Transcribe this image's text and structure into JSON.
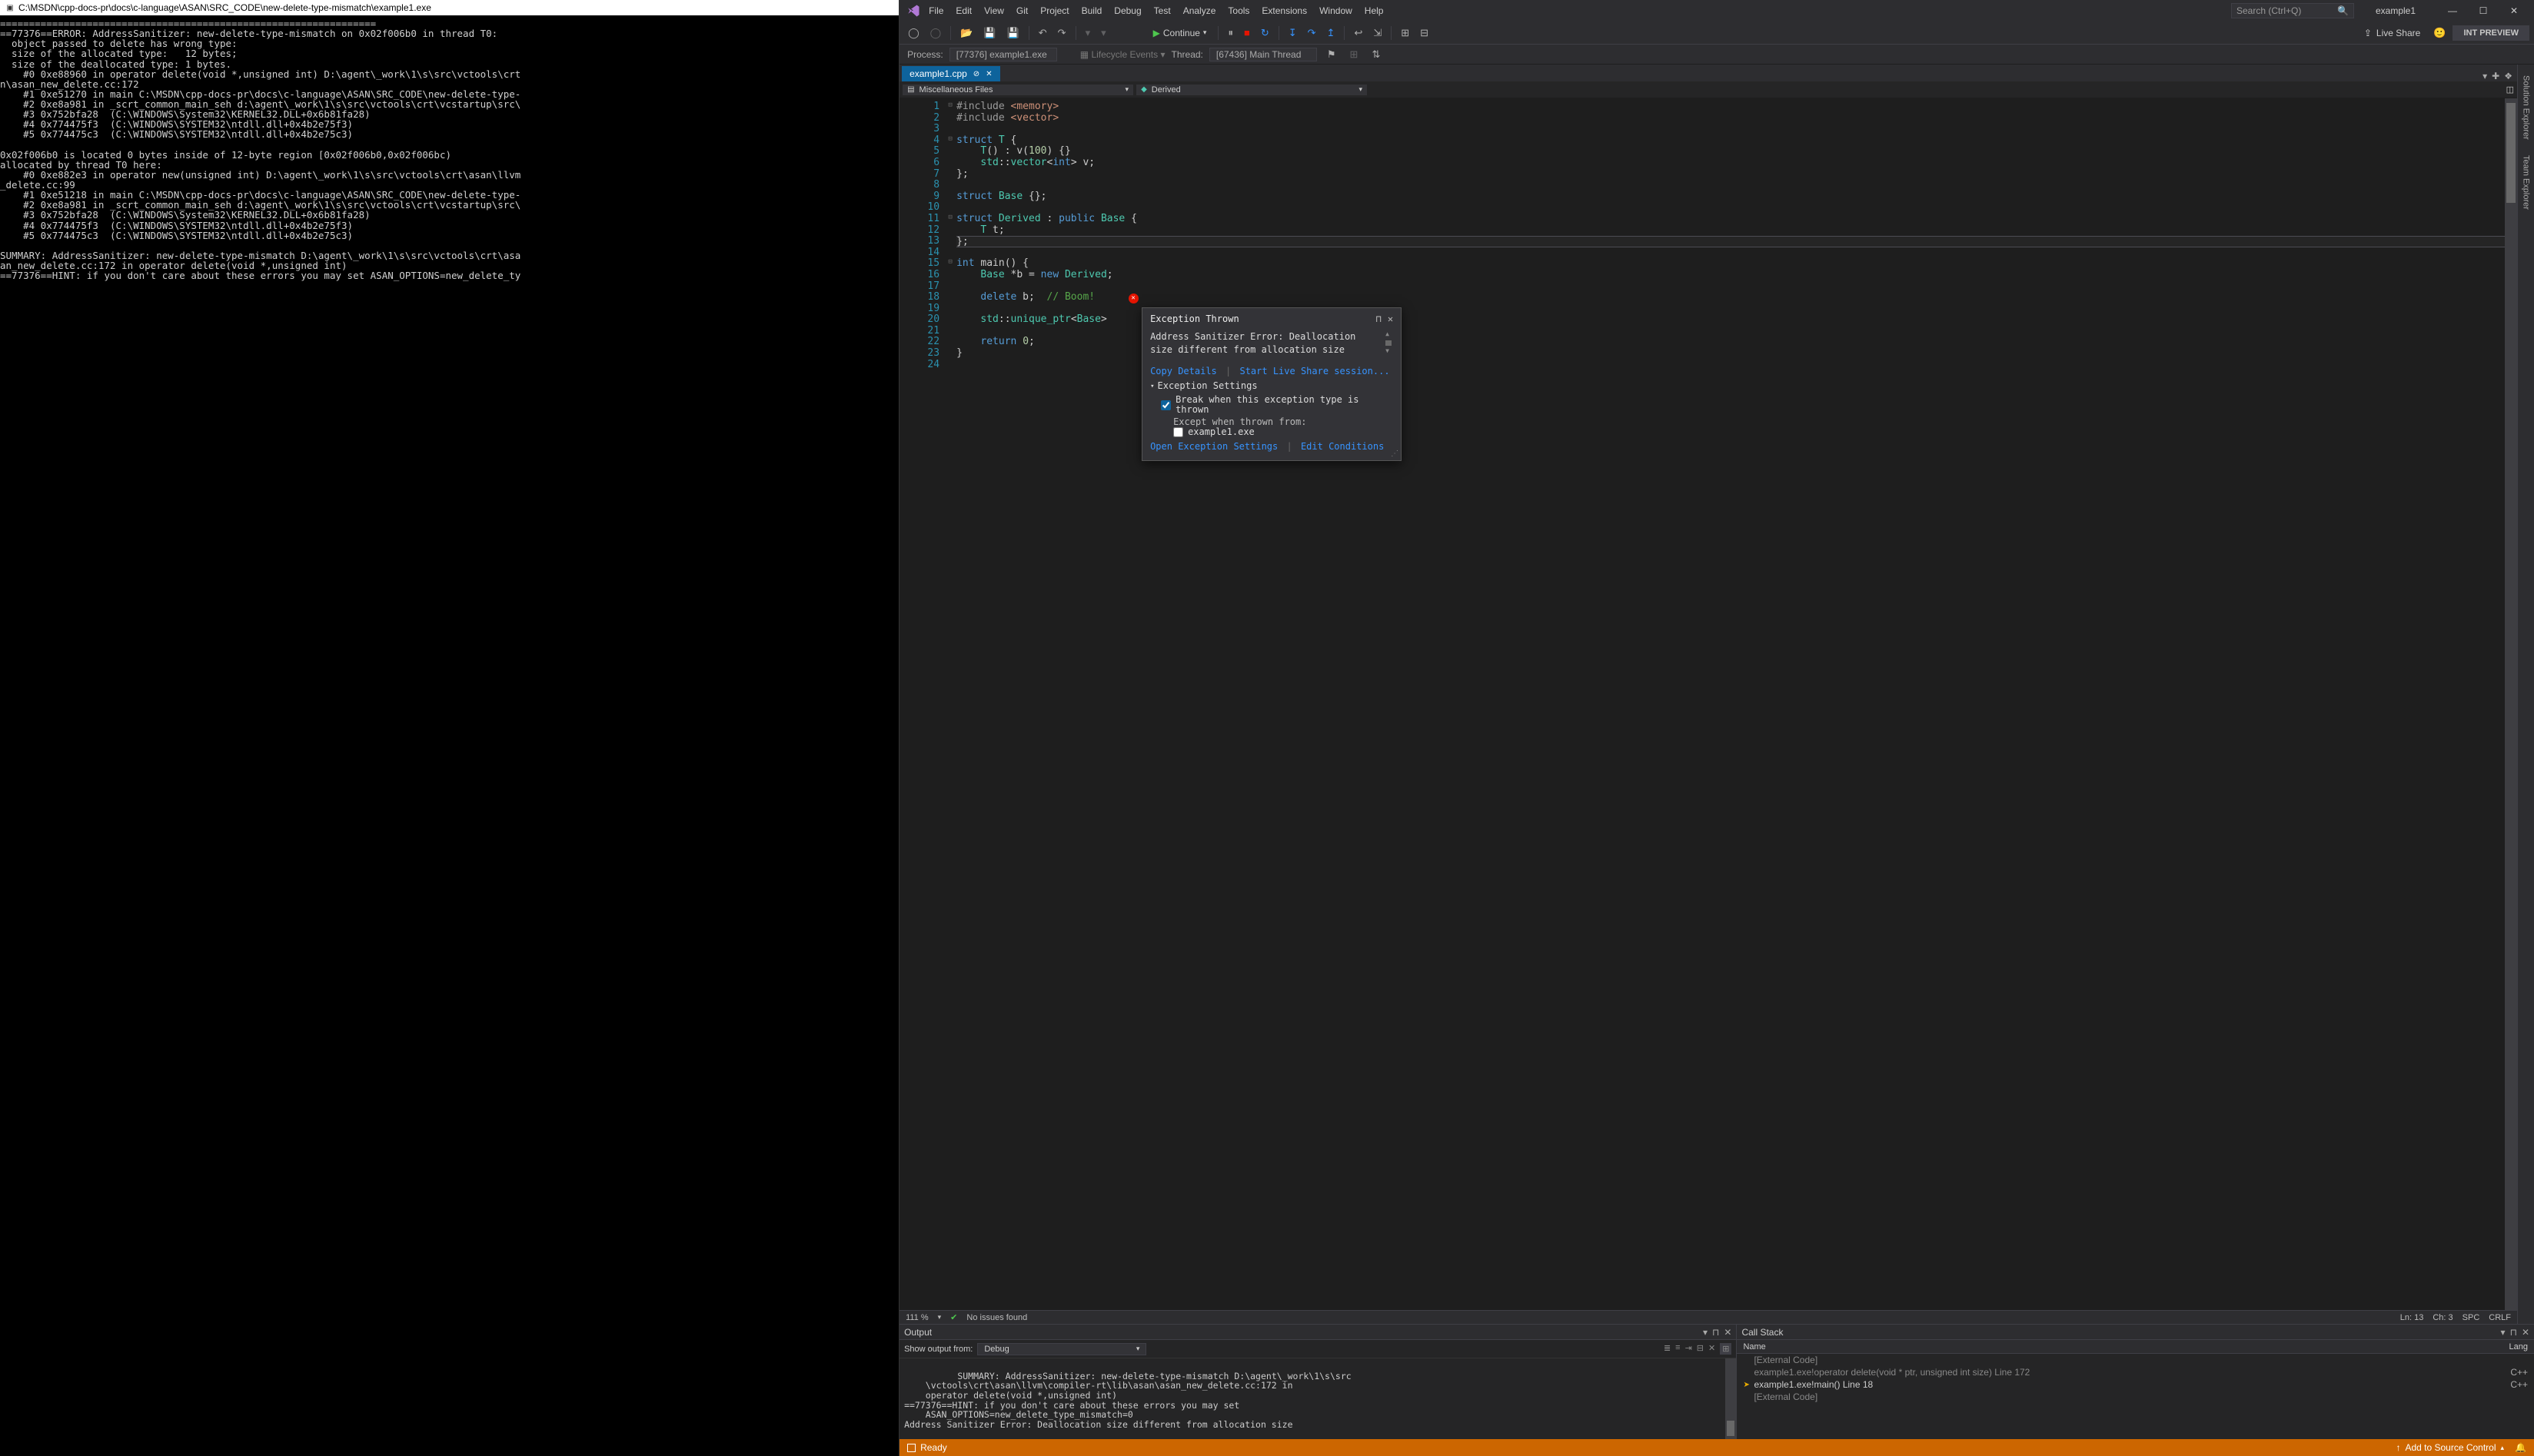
{
  "console": {
    "title": "C:\\MSDN\\cpp-docs-pr\\docs\\c-language\\ASAN\\SRC_CODE\\new-delete-type-mismatch\\example1.exe",
    "body": "=================================================================\n==77376==ERROR: AddressSanitizer: new-delete-type-mismatch on 0x02f006b0 in thread T0:\n  object passed to delete has wrong type:\n  size of the allocated type:   12 bytes;\n  size of the deallocated type: 1 bytes.\n    #0 0xe88960 in operator delete(void *,unsigned int) D:\\agent\\_work\\1\\s\\src\\vctools\\crt\nn\\asan_new_delete.cc:172\n    #1 0xe51270 in main C:\\MSDN\\cpp-docs-pr\\docs\\c-language\\ASAN\\SRC_CODE\\new-delete-type-\n    #2 0xe8a981 in _scrt_common_main_seh d:\\agent\\_work\\1\\s\\src\\vctools\\crt\\vcstartup\\src\\\n    #3 0x752bfa28  (C:\\WINDOWS\\System32\\KERNEL32.DLL+0x6b81fa28)\n    #4 0x774475f3  (C:\\WINDOWS\\SYSTEM32\\ntdll.dll+0x4b2e75f3)\n    #5 0x774475c3  (C:\\WINDOWS\\SYSTEM32\\ntdll.dll+0x4b2e75c3)\n\n0x02f006b0 is located 0 bytes inside of 12-byte region [0x02f006b0,0x02f006bc)\nallocated by thread T0 here:\n    #0 0xe882e3 in operator new(unsigned int) D:\\agent\\_work\\1\\s\\src\\vctools\\crt\\asan\\llvm\n_delete.cc:99\n    #1 0xe51218 in main C:\\MSDN\\cpp-docs-pr\\docs\\c-language\\ASAN\\SRC_CODE\\new-delete-type-\n    #2 0xe8a981 in _scrt_common_main_seh d:\\agent\\_work\\1\\s\\src\\vctools\\crt\\vcstartup\\src\\\n    #3 0x752bfa28  (C:\\WINDOWS\\System32\\KERNEL32.DLL+0x6b81fa28)\n    #4 0x774475f3  (C:\\WINDOWS\\SYSTEM32\\ntdll.dll+0x4b2e75f3)\n    #5 0x774475c3  (C:\\WINDOWS\\SYSTEM32\\ntdll.dll+0x4b2e75c3)\n\nSUMMARY: AddressSanitizer: new-delete-type-mismatch D:\\agent\\_work\\1\\s\\src\\vctools\\crt\\asa\nan_new_delete.cc:172 in operator delete(void *,unsigned int)\n==77376==HINT: if you don't care about these errors you may set ASAN_OPTIONS=new_delete_ty"
  },
  "menu": [
    "File",
    "Edit",
    "View",
    "Git",
    "Project",
    "Build",
    "Debug",
    "Test",
    "Analyze",
    "Tools",
    "Extensions",
    "Window",
    "Help"
  ],
  "search_placeholder": "Search (Ctrl+Q)",
  "solution": "example1",
  "toolbar": {
    "continue": "Continue",
    "live_share": "Live Share",
    "int_preview": "INT PREVIEW"
  },
  "process": {
    "label": "Process:",
    "value": "[77376] example1.exe",
    "lifecycle": "Lifecycle Events",
    "thread_label": "Thread:",
    "thread_value": "[67436] Main Thread"
  },
  "tab": {
    "name": "example1.cpp"
  },
  "nav": {
    "left": "Miscellaneous Files",
    "right": "Derived"
  },
  "code_lines": 24,
  "editor_status": {
    "zoom": "111 %",
    "issues": "No issues found",
    "ln": "Ln: 13",
    "ch": "Ch: 3",
    "spc": "SPC",
    "crlf": "CRLF"
  },
  "exception": {
    "title": "Exception Thrown",
    "message": "Address Sanitizer Error: Deallocation size different from allocation size",
    "copy": "Copy Details",
    "live": "Start Live Share session...",
    "settings_hdr": "Exception Settings",
    "break_label": "Break when this exception type is thrown",
    "except_label": "Except when thrown from:",
    "except_item": "example1.exe",
    "open_settings": "Open Exception Settings",
    "edit_cond": "Edit Conditions"
  },
  "output": {
    "title": "Output",
    "from_label": "Show output from:",
    "from_value": "Debug",
    "body": "SUMMARY: AddressSanitizer: new-delete-type-mismatch D:\\agent\\_work\\1\\s\\src\n    \\vctools\\crt\\asan\\llvm\\compiler-rt\\lib\\asan\\asan_new_delete.cc:172 in\n    operator delete(void *,unsigned int)\n==77376==HINT: if you don't care about these errors you may set\n    ASAN_OPTIONS=new_delete_type_mismatch=0\nAddress Sanitizer Error: Deallocation size different from allocation size\n"
  },
  "callstack": {
    "title": "Call Stack",
    "col_name": "Name",
    "col_lang": "Lang",
    "rows": [
      {
        "name": "[External Code]",
        "lang": "",
        "dim": true,
        "arrow": false
      },
      {
        "name": "example1.exe!operator delete(void * ptr, unsigned int size) Line 172",
        "lang": "C++",
        "dim": true,
        "arrow": false
      },
      {
        "name": "example1.exe!main() Line 18",
        "lang": "C++",
        "dim": false,
        "arrow": true
      },
      {
        "name": "[External Code]",
        "lang": "",
        "dim": true,
        "arrow": false
      }
    ]
  },
  "status": {
    "ready": "Ready",
    "add_source": "Add to Source Control"
  },
  "side_tabs": [
    "Solution Explorer",
    "Team Explorer"
  ]
}
